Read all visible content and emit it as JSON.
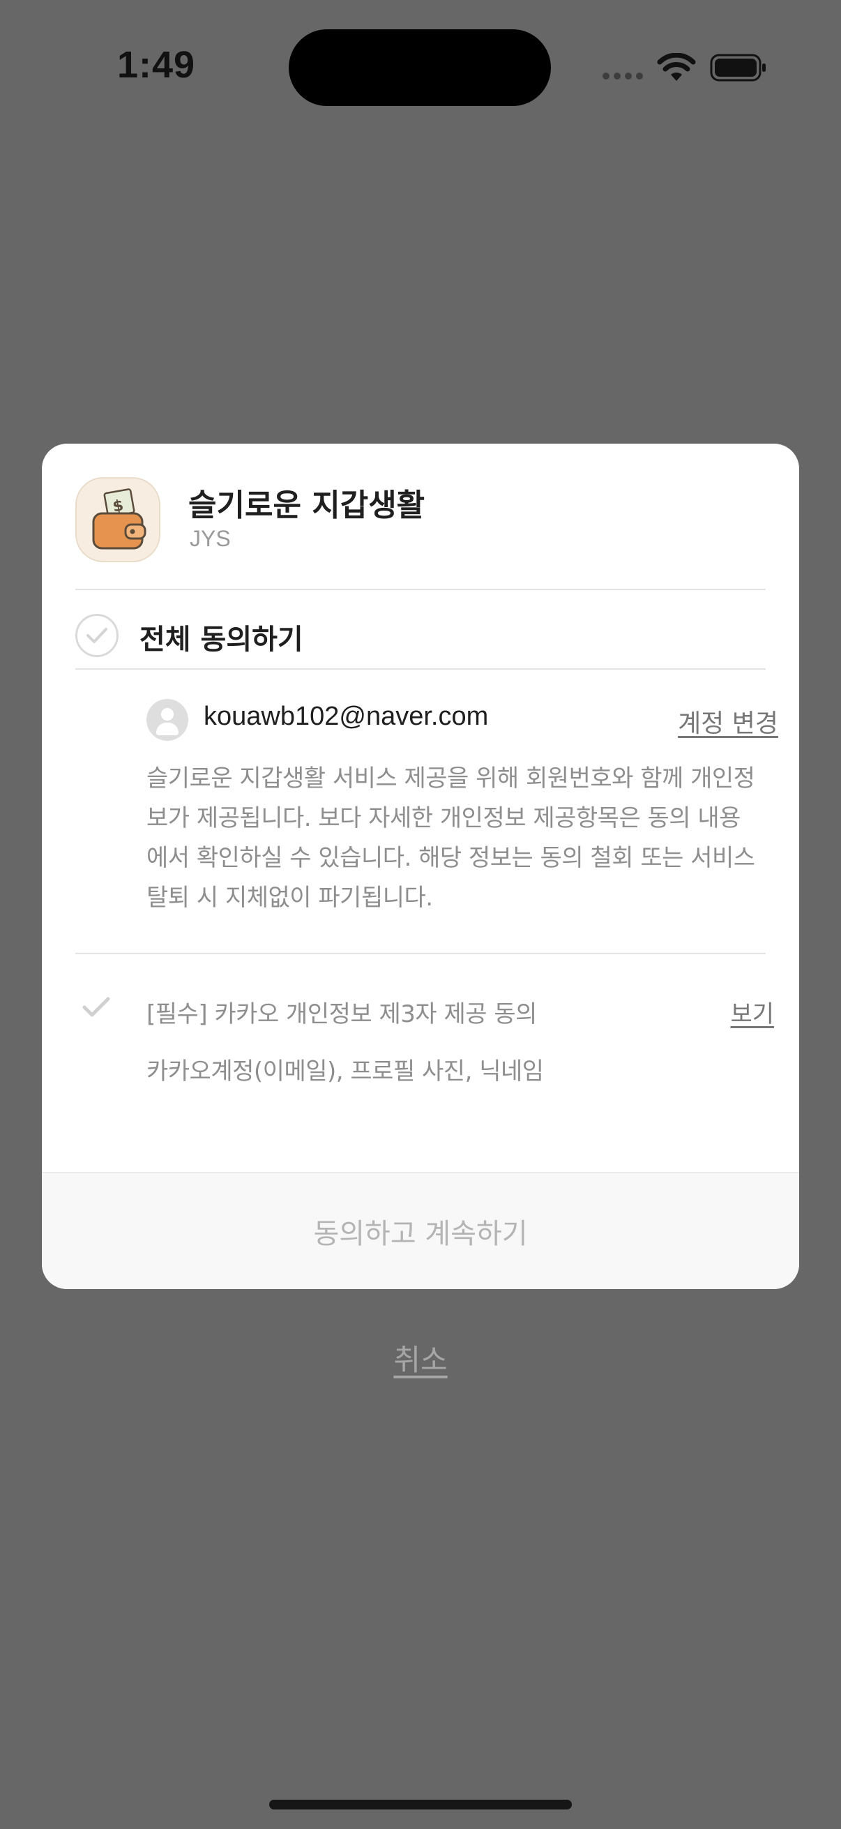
{
  "status_bar": {
    "time": "1:49"
  },
  "dialog": {
    "app": {
      "name": "슬기로운 지갑생활",
      "developer": "JYS",
      "icon": "wallet-icon"
    },
    "agree_all_label": "전체 동의하기",
    "account": {
      "email": "kouawb102@naver.com",
      "change_label": "계정 변경"
    },
    "description": "슬기로운 지갑생활 서비스 제공을 위해 회원번호와 함께 개인정보가 제공됩니다. 보다 자세한 개인정보 제공항목은 동의 내용에서 확인하실 수 있습니다. 해당 정보는 동의 철회 또는 서비스 탈퇴 시 지체없이 파기됩니다.",
    "consent": {
      "label": "[필수] 카카오 개인정보 제3자 제공 동의",
      "view_label": "보기",
      "items": "카카오계정(이메일), 프로필 사진, 닉네임"
    },
    "continue_label": "동의하고 계속하기"
  },
  "cancel_label": "취소",
  "colors": {
    "backdrop": "#676767",
    "dialog_bg": "#ffffff",
    "muted_text": "#8e8e8e",
    "disabled_button_text": "#b4b4b4"
  }
}
